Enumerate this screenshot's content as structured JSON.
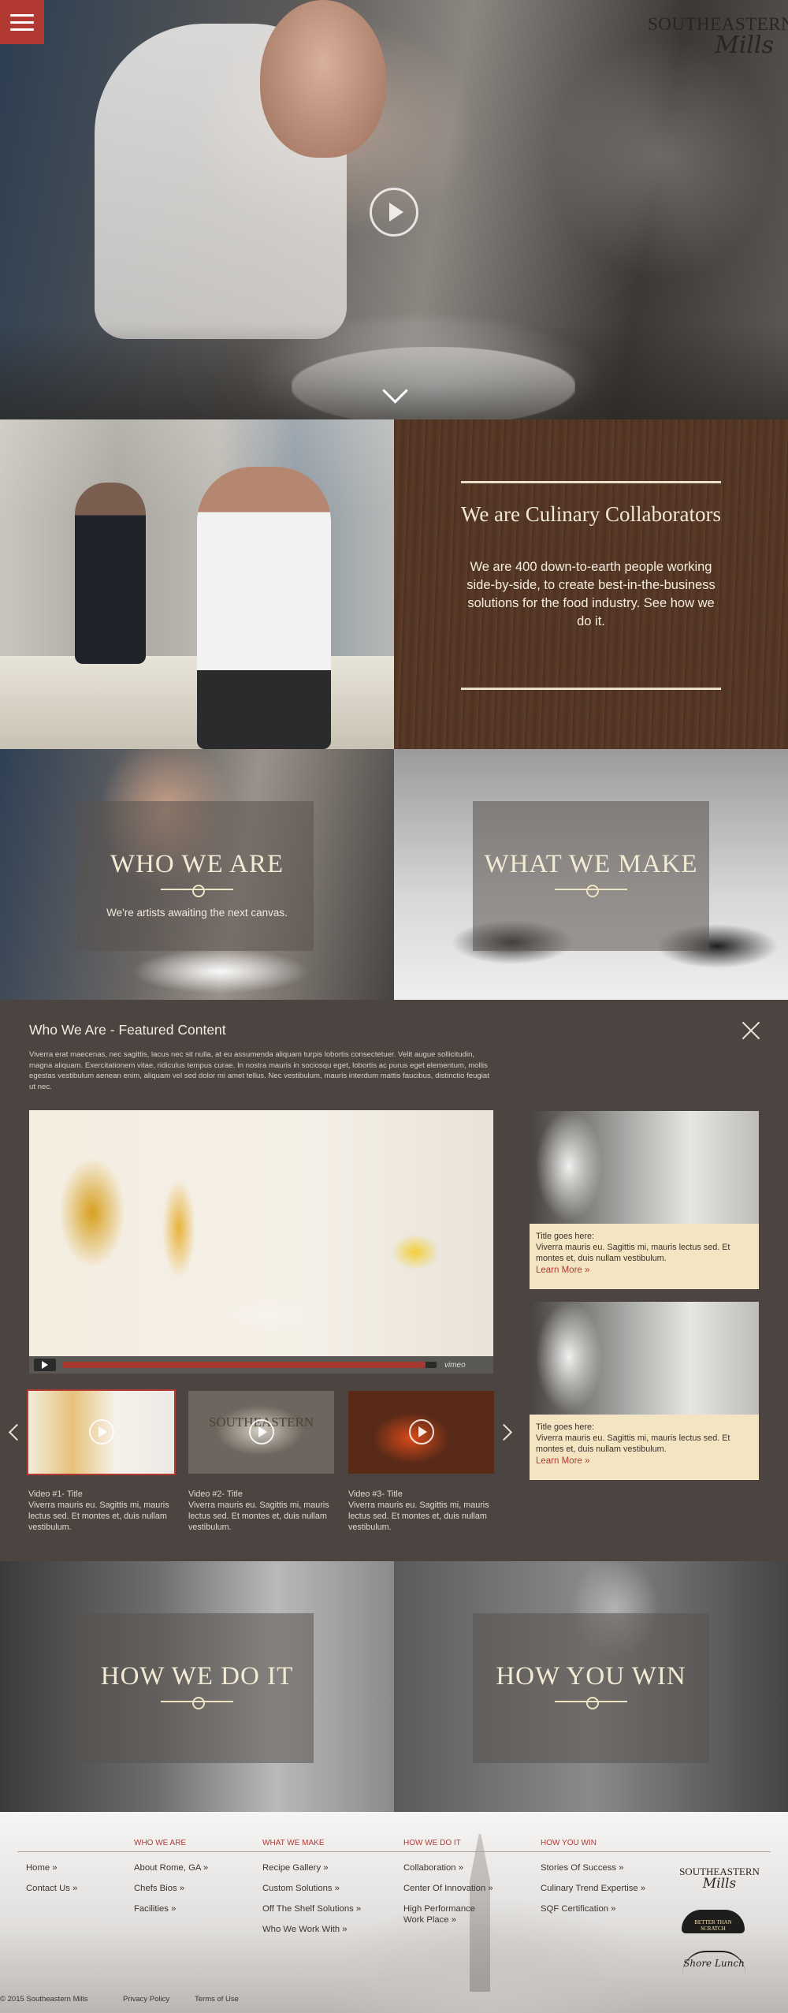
{
  "brand": {
    "line1": "SOUTHEASTERN",
    "line2": "Mills"
  },
  "hero": {
    "menu_icon": "hamburger-icon",
    "play_icon": "play-icon",
    "scroll_icon": "chevron-down-icon"
  },
  "culinary": {
    "title": "We are Culinary Collaborators",
    "body": "We are 400 down-to-earth people working side-by-side, to create best-in-the-business solutions for the food industry. See how we do it."
  },
  "tiles": {
    "who": {
      "title": "WHO WE ARE",
      "subtitle": "We're artists awaiting the next canvas."
    },
    "what": {
      "title": "WHAT WE MAKE"
    },
    "how": {
      "title": "HOW WE DO IT"
    },
    "win": {
      "title": "HOW YOU WIN"
    }
  },
  "featured": {
    "heading": "Who We Are - Featured Content",
    "intro": "Viverra erat maecenas, nec sagittis, lacus nec sit nulla, at eu assumenda aliquam turpis lobortis consectetuer. Velit augue sollicitudin, magna aliquam. Exercitationem vitae, ridiculus tempus curae. In nostra mauris in sociosqu eget, lobortis ac purus eget elementum, mollis egestas vestibulum aenean enim, aliquam vel sed dolor mi amet tellus. Nec vestibulum, mauris interdum mattis faucibus, distinctio feugiat ut nec.",
    "video": {
      "brand": "vimeo",
      "progress": 0.97
    },
    "thumbs": [
      {
        "title": "Video #1- Title",
        "text": "Viverra mauris eu. Sagittis mi, mauris lectus sed. Et montes et, duis nullam vestibulum."
      },
      {
        "title": "Video #2- Title",
        "text": "Viverra mauris eu. Sagittis mi, mauris lectus sed. Et montes et, duis nullam vestibulum.",
        "mug_text": "SOUTHEASTERN"
      },
      {
        "title": "Video #3- Title",
        "text": "Viverra mauris eu. Sagittis mi, mauris lectus sed. Et montes et, duis nullam vestibulum."
      }
    ],
    "cards": [
      {
        "title": "Title goes here:",
        "text": "Viverra mauris eu. Sagittis mi, mauris lectus sed. Et montes et, duis nullam vestibulum.",
        "link": "Learn More »"
      },
      {
        "title": "Title goes here:",
        "text": "Viverra mauris eu. Sagittis mi, mauris lectus sed. Et montes et, duis nullam vestibulum.",
        "link": "Learn More »"
      }
    ]
  },
  "footer": {
    "col0": [
      "Home »",
      "Contact Us »"
    ],
    "col1": {
      "head": "WHO WE ARE",
      "links": [
        "About Rome, GA »",
        "Chefs Bios »",
        "Facilities »"
      ]
    },
    "col2": {
      "head": "WHAT WE MAKE",
      "links": [
        "Recipe Gallery »",
        "Custom Solutions »",
        "Off The Shelf Solutions »",
        "Who We Work With »"
      ]
    },
    "col3": {
      "head": "HOW WE DO IT",
      "links": [
        "Collaboration »",
        "Center Of Innovation »",
        "High Performance Work Place »"
      ]
    },
    "col4": {
      "head": "HOW YOU WIN",
      "links": [
        "Stories Of Success »",
        "Culinary Trend Expertise »",
        "SQF Certification »"
      ]
    },
    "logo": {
      "line1": "SOUTHEASTERN",
      "line2": "Mills"
    },
    "badge": "BETTER THAN SCRATCH",
    "shore": "Shore Lunch",
    "copyright": "© 2015 Southeastern Mills",
    "privacy": "Privacy Policy",
    "terms": "Terms of Use"
  }
}
